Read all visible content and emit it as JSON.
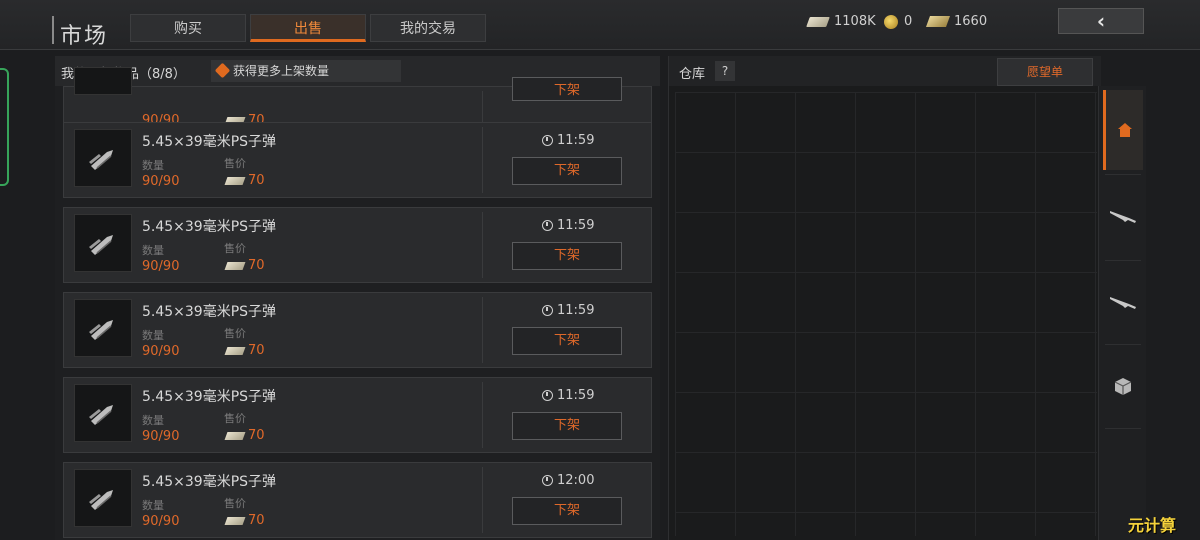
{
  "header": {
    "title": "市场",
    "tabs": {
      "buy": "购买",
      "sell": "出售",
      "trades": "我的交易"
    },
    "currency": {
      "cash": "1108K",
      "coins": "0",
      "gold": "1660"
    },
    "back_label": "‹"
  },
  "listings": {
    "title": "我的上架物品（8/8）",
    "more_slots": "获得更多上架数量",
    "qty_label": "数量",
    "price_label": "售价",
    "delist_label": "下架",
    "partial_row": {
      "qty": "90/90",
      "price": "70",
      "delist": "下架"
    },
    "rows": [
      {
        "name": "5.45×39毫米PS子弹",
        "qty": "90/90",
        "price": "70",
        "time": "11:59"
      },
      {
        "name": "5.45×39毫米PS子弹",
        "qty": "90/90",
        "price": "70",
        "time": "11:59"
      },
      {
        "name": "5.45×39毫米PS子弹",
        "qty": "90/90",
        "price": "70",
        "time": "11:59"
      },
      {
        "name": "5.45×39毫米PS子弹",
        "qty": "90/90",
        "price": "70",
        "time": "11:59"
      },
      {
        "name": "5.45×39毫米PS子弹",
        "qty": "90/90",
        "price": "70",
        "time": "12:00"
      }
    ]
  },
  "warehouse": {
    "title": "仓库",
    "help": "?",
    "wishlist": "愿望单"
  },
  "sidebar": [
    "home-icon",
    "rifle-icon",
    "rifle-icon",
    "box-icon"
  ],
  "watermark": "元计算",
  "colors": {
    "accent": "#e06a1f",
    "price": "#e0692a",
    "background": "#1c1d1f"
  }
}
